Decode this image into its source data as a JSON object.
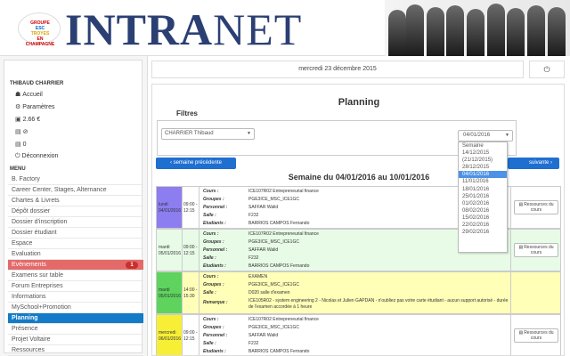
{
  "header": {
    "logo": {
      "line1": "GROUPE",
      "line2": "ESC",
      "line3": "TROYES",
      "line4": "EN CHAMPAGNE"
    },
    "title_thin": "INTRA",
    "title_bold": "NET"
  },
  "top": {
    "date": "mercredi 23 décembre 2015",
    "power": "⏻"
  },
  "sidebar": {
    "user_name": "THIBAUD CHARRIER",
    "links": [
      {
        "icon": "☗",
        "label": "Accueil"
      },
      {
        "icon": "⚙",
        "label": "Paramètres"
      },
      {
        "icon": "▣",
        "label": "2.66 €"
      },
      {
        "icon": "▤",
        "label": "⊘"
      },
      {
        "icon": "▤",
        "label": "0"
      },
      {
        "icon": "⏻",
        "label": "Déconnexion"
      }
    ],
    "menu_label": "MENU",
    "menu": [
      {
        "label": "B. Factory"
      },
      {
        "label": "Career Center, Stages, Alternance"
      },
      {
        "label": "Chartes & Livrets"
      },
      {
        "label": "Dépôt dossier"
      },
      {
        "label": "Dossier d'inscription"
      },
      {
        "label": "Dossier étudiant"
      },
      {
        "label": "Espace"
      },
      {
        "label": "Evaluation"
      },
      {
        "label": "Evènements",
        "badge": "1"
      },
      {
        "label": "Examens sur table"
      },
      {
        "label": "Forum Entreprises"
      },
      {
        "label": "Informations"
      },
      {
        "label": "MySchool+Promotion"
      },
      {
        "label": "Planning"
      },
      {
        "label": "Présence"
      },
      {
        "label": "Projet Voltaire"
      },
      {
        "label": "Ressources"
      }
    ]
  },
  "planning": {
    "title": "Planning",
    "filters_label": "Filtres",
    "person_select": "CHARRIER Thibaud",
    "week_select": "04/01/2016",
    "dropdown_options": [
      "Semaine",
      "14/12/2015",
      "(21/12/2015)",
      "28/12/2015",
      "04/01/2016",
      "11/01/2016",
      "18/01/2016",
      "25/01/2016",
      "01/02/2016",
      "08/02/2016",
      "15/02/2016",
      "22/02/2016",
      "29/02/2016"
    ],
    "prev_button": "‹ semaine précédente",
    "next_button": "suivante ›",
    "week_title": "Semaine du 04/01/2016 au 10/01/2016"
  },
  "events": [
    {
      "day": "lundi",
      "date": "04/01/2016",
      "start": "09:00",
      "end": "12:15",
      "course": "ICE107R02 Entrepreneurial finance",
      "groups": "PGE3ICE_MSC_ICE1GC",
      "staff": "SAFFAR Walid",
      "room": "F232",
      "students": "BARRIOS CAMPOS Fernando",
      "resource": "Ressources du cours"
    },
    {
      "day": "mardi",
      "date": "05/01/2016",
      "start": "09:00",
      "end": "12:15",
      "course": "ICE107R02 Entrepreneurial finance",
      "groups": "PGE3ICE_MSC_ICE1GC",
      "staff": "SAFFAR Walid",
      "room": "F232",
      "students": "BARRIOS CAMPOS Fernando",
      "resource": "Ressources du cours"
    },
    {
      "day": "mardi",
      "date": "05/01/2016",
      "start": "14:00",
      "end": "15:30",
      "course": "EXAMEN",
      "groups": "PGE3ICE_MSC_ICE1GC",
      "room": "D020 salle d'examen",
      "remark": "ICE105R02 - system engineering 2 - Nicolas et Julien GAPDAN - n'oubliez pas votre carte étudiant - aucun support autorisé - durée de l'examen accordée à 1 heure"
    },
    {
      "day": "mercredi",
      "date": "06/01/2016",
      "start": "09:00",
      "end": "12:15",
      "course": "ICE107R02 Entrepreneurial finance",
      "groups": "PGE3ICE_MSC_ICE1GC",
      "staff": "SAFFAR Walid",
      "room": "F232",
      "students": "BARRIOS CAMPOS Fernando",
      "resource": "Ressources du cours"
    }
  ],
  "labels": {
    "course": "Cours :",
    "groups": "Groupes :",
    "staff": "Personnel :",
    "room": "Salle :",
    "students": "Etudiants :",
    "remark": "Remarque :"
  },
  "colors": {
    "accent": "#137bc8",
    "events_badge": "#c9302c",
    "week_button": "#1f6fd1",
    "day_purple": "#8c7df0",
    "day_green": "#5ed45e",
    "day_yellow": "#f7ef36",
    "exam_background": "#ffffb8"
  },
  "icons": [
    "home-icon",
    "gear-icon",
    "wallet-icon",
    "ban-icon",
    "message-icon",
    "power-icon",
    "document-icon",
    "chevron-left-icon",
    "chevron-right-icon",
    "dropdown-caret-icon"
  ]
}
